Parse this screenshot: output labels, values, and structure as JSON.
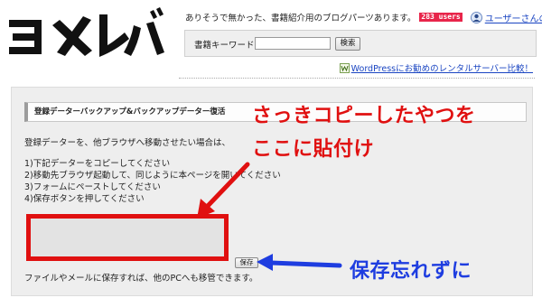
{
  "header": {
    "logo_text": "ヨメレバ",
    "tagline": "ありそうで無かった、書籍紹介用のブログパーツあります。",
    "users_badge": "283 users",
    "voice_link": "ユーザーさんの声",
    "search": {
      "label": "書籍キーワード:",
      "value": "",
      "button": "検索"
    },
    "wp_link": "WordPressにお勧めのレンタルサーバー比較！"
  },
  "backup": {
    "title": "登録データーバックアップ&バックアップデーター復活",
    "intro": "登録データーを、他ブラウザへ移動させたい場合は、",
    "steps": [
      "1)下記データーをコピーしてください",
      "2)移動先ブラウザ起動して、同じように本ページを開いてください",
      "3)フォームにペーストしてください",
      "4)保存ボタンを押してください"
    ],
    "textarea_value": "",
    "save_button": "保存",
    "footer": "ファイルやメールに保存すれば、他のPCへも移管できます。"
  },
  "annotations": {
    "copy_line1": "さっきコピーしたやつを",
    "copy_line2": "ここに貼付け",
    "save_note": "保存忘れずに",
    "copy_color": "#e01010",
    "save_color": "#1e3de0"
  }
}
